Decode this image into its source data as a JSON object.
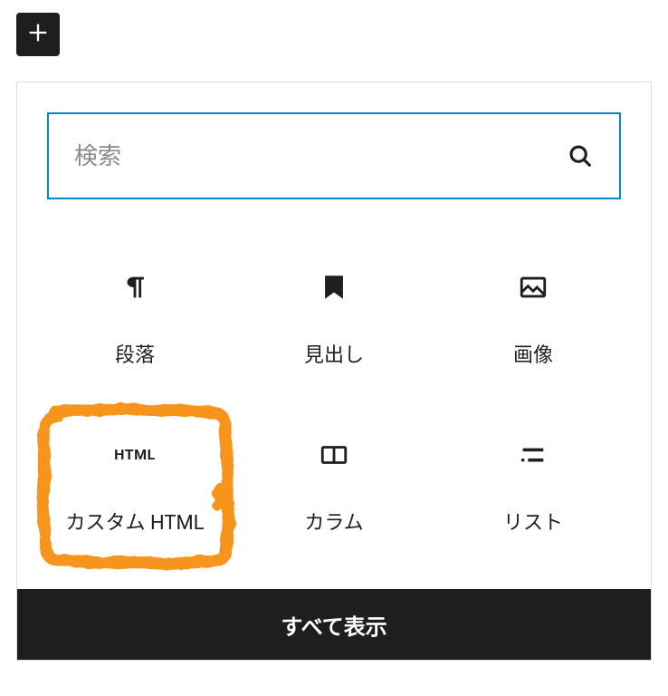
{
  "add_button": {
    "icon": "plus-icon"
  },
  "search": {
    "placeholder": "検索"
  },
  "blocks": [
    {
      "id": "paragraph",
      "label": "段落",
      "icon": "pilcrow-icon",
      "highlighted": false
    },
    {
      "id": "heading",
      "label": "見出し",
      "icon": "bookmark-icon",
      "highlighted": false
    },
    {
      "id": "image",
      "label": "画像",
      "icon": "image-icon",
      "highlighted": false
    },
    {
      "id": "custom-html",
      "label": "カスタム HTML",
      "icon": "html-icon",
      "highlighted": true
    },
    {
      "id": "columns",
      "label": "カラム",
      "icon": "columns-icon",
      "highlighted": false
    },
    {
      "id": "list",
      "label": "リスト",
      "icon": "list-icon",
      "highlighted": false
    }
  ],
  "footer": {
    "show_all_label": "すべて表示"
  },
  "annotation": {
    "color": "#f7941d"
  }
}
